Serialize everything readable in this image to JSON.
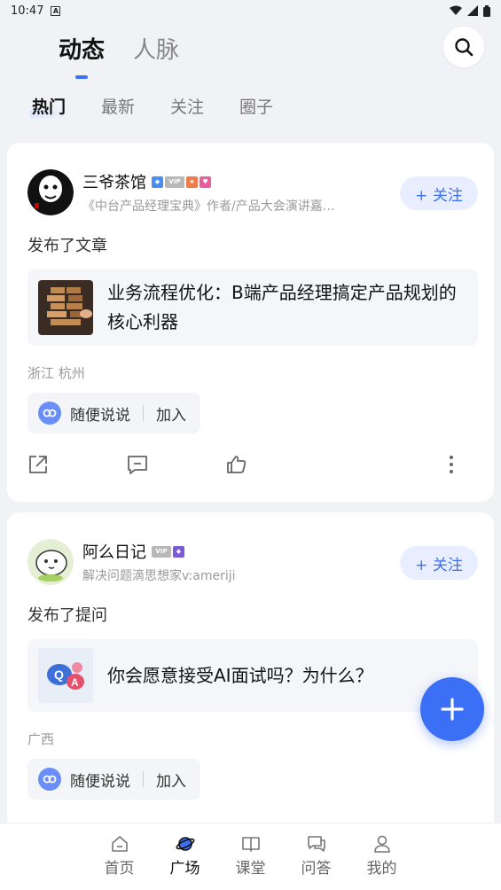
{
  "status_bar": {
    "time": "10:47"
  },
  "header": {
    "tabs": [
      {
        "label": "动态",
        "active": true
      },
      {
        "label": "人脉",
        "active": false
      }
    ]
  },
  "sub_tabs": [
    {
      "label": "热门",
      "active": true
    },
    {
      "label": "最新",
      "active": false
    },
    {
      "label": "关注",
      "active": false
    },
    {
      "label": "圈子",
      "active": false
    }
  ],
  "posts": [
    {
      "author": "三爷茶馆",
      "desc": "《中台产品经理宝典》作者/产品大会演讲嘉…",
      "follow_label": "+ 关注",
      "action": "发布了文章",
      "content_title": "业务流程优化：B端产品经理搞定产品规划的核心利器",
      "location": "浙江 杭州",
      "circle": "随便说说",
      "join_label": "加入"
    },
    {
      "author": "阿么日记",
      "desc": "解决问题滴思想家v:ameriji",
      "follow_label": "+ 关注",
      "action": "发布了提问",
      "content_title": "你会愿意接受AI面试吗？为什么？",
      "location": "广西",
      "circle": "随便说说",
      "join_label": "加入"
    }
  ],
  "bottom_nav": [
    {
      "label": "首页",
      "icon": "home-icon",
      "active": false
    },
    {
      "label": "广场",
      "icon": "planet-icon",
      "active": true
    },
    {
      "label": "课堂",
      "icon": "book-icon",
      "active": false
    },
    {
      "label": "问答",
      "icon": "chat-icon",
      "active": false
    },
    {
      "label": "我的",
      "icon": "user-icon",
      "active": false
    }
  ],
  "colors": {
    "accent": "#3b6ff5",
    "follow_bg": "#e8eeff",
    "page_bg": "#f1f2f6"
  }
}
